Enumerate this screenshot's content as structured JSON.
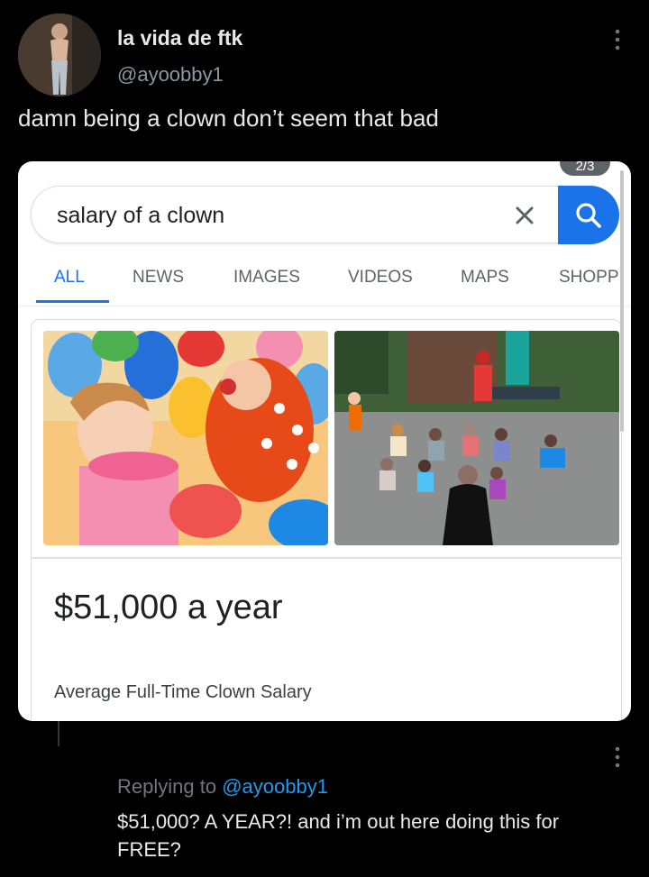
{
  "tweet": {
    "author_name": "la vida de ftk",
    "author_handle": "@ayoobby1",
    "text": "damn being a clown don’t seem that bad"
  },
  "media": {
    "counter": "2/3",
    "search": {
      "query": "salary of a clown"
    },
    "tabs": [
      {
        "label": "ALL",
        "active": true
      },
      {
        "label": "NEWS",
        "active": false
      },
      {
        "label": "IMAGES",
        "active": false
      },
      {
        "label": "VIDEOS",
        "active": false
      },
      {
        "label": "MAPS",
        "active": false
      },
      {
        "label": "SHOPP",
        "active": false
      }
    ],
    "result": {
      "value": "$51,000 a year",
      "caption": "Average Full-Time Clown Salary"
    }
  },
  "reply": {
    "replying_to_label": "Replying to",
    "replying_to_handle": "@ayoobby1",
    "text": "$51,000? A YEAR?! and i’m out here doing this for FREE?"
  },
  "colors": {
    "background": "#000000",
    "text_primary": "#e7e9ea",
    "text_secondary": "#71767b",
    "link": "#1d9bf0",
    "google_blue": "#1a73e8"
  }
}
